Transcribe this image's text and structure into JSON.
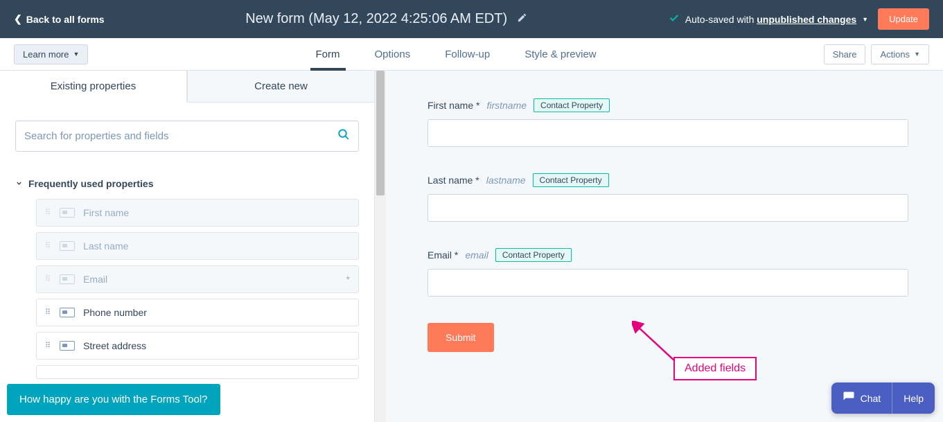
{
  "header": {
    "back_label": "Back to all forms",
    "form_title": "New form (May 12, 2022 4:25:06 AM EDT)",
    "autosave_prefix": "Auto-saved with ",
    "autosave_emphasis": "unpublished changes",
    "update_label": "Update"
  },
  "toolbar": {
    "learn_more": "Learn more",
    "tabs": {
      "form": "Form",
      "options": "Options",
      "followup": "Follow-up",
      "style": "Style & preview"
    },
    "share": "Share",
    "actions": "Actions"
  },
  "left": {
    "tab_existing": "Existing properties",
    "tab_create": "Create new",
    "search_placeholder": "Search for properties and fields",
    "section_title": "Frequently used properties",
    "props": [
      {
        "label": "First name",
        "disabled": true,
        "star": false
      },
      {
        "label": "Last name",
        "disabled": true,
        "star": false
      },
      {
        "label": "Email",
        "disabled": true,
        "star": true
      },
      {
        "label": "Phone number",
        "disabled": false,
        "star": false
      },
      {
        "label": "Street address",
        "disabled": false,
        "star": false
      }
    ]
  },
  "canvas": {
    "fields": [
      {
        "label": "First name *",
        "internal": "firstname",
        "badge": "Contact Property"
      },
      {
        "label": "Last name *",
        "internal": "lastname",
        "badge": "Contact Property"
      },
      {
        "label": "Email *",
        "internal": "email",
        "badge": "Contact Property"
      }
    ],
    "submit": "Submit"
  },
  "annotation": {
    "label": "Added fields"
  },
  "feedback": {
    "prompt": "How happy are you with the Forms Tool?"
  },
  "widget": {
    "chat": "Chat",
    "help": "Help"
  }
}
